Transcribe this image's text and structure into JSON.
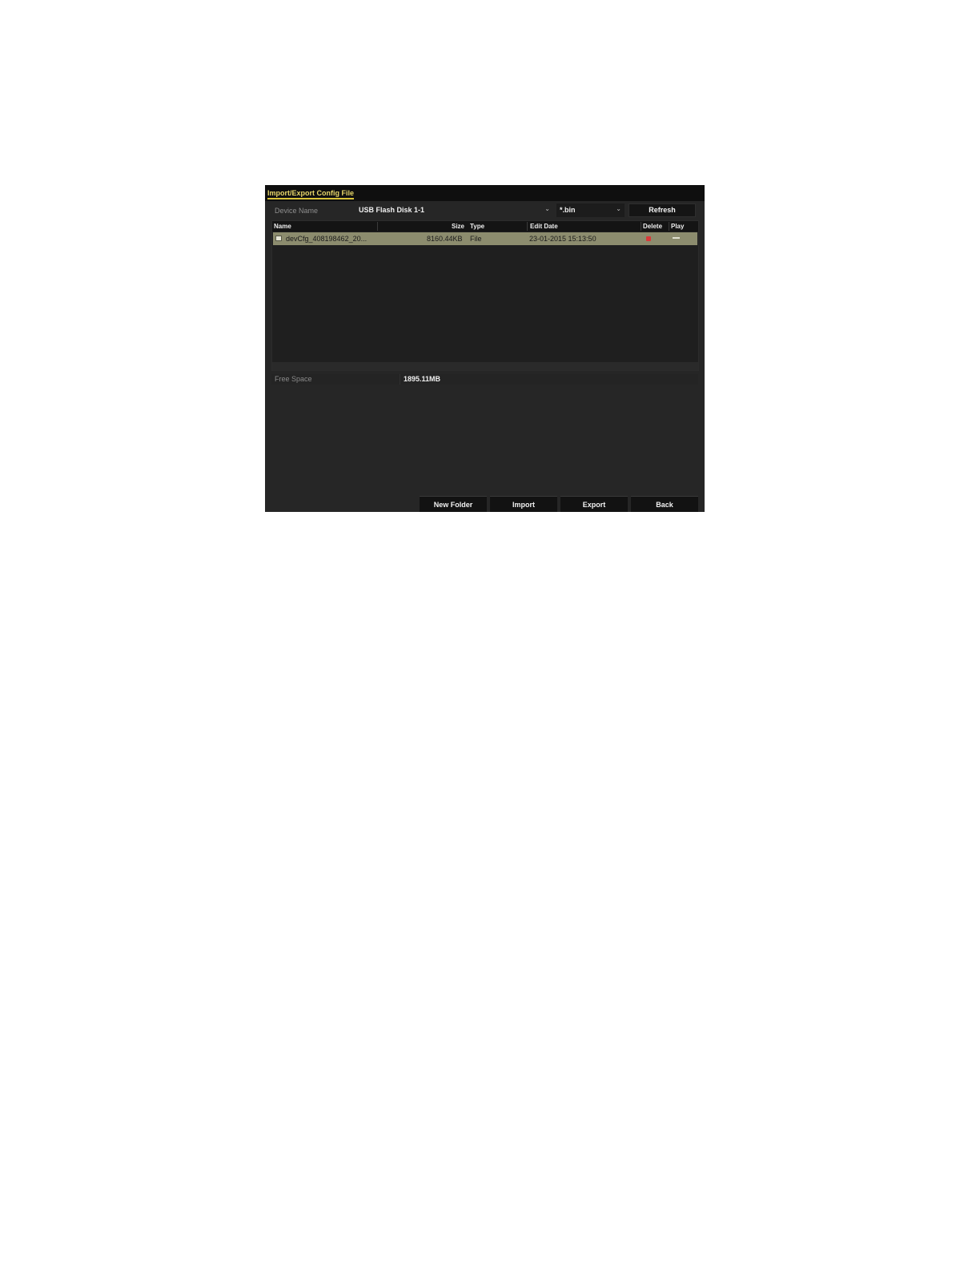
{
  "dialog": {
    "title": "Import/Export Config File"
  },
  "device": {
    "label": "Device Name",
    "selected": "USB Flash Disk 1-1",
    "filter": "*.bin",
    "refresh_label": "Refresh"
  },
  "table": {
    "columns": {
      "name": "Name",
      "size": "Size",
      "type": "Type",
      "edit_date": "Edit Date",
      "delete": "Delete",
      "play": "Play"
    },
    "rows": [
      {
        "name": "devCfg_408198462_20...",
        "size": "8160.44KB",
        "type": "File",
        "edit_date": "23-01-2015 15:13:50",
        "delete_icon": "delete-icon",
        "play_icon": "dash-icon"
      }
    ]
  },
  "storage": {
    "free_space_label": "Free Space",
    "free_space_value": "1895.11MB"
  },
  "buttons": {
    "new_folder": "New Folder",
    "import": "Import",
    "export": "Export",
    "back": "Back"
  },
  "colors": {
    "accent": "#d9c23a",
    "background": "#262626",
    "selected_row": "#8c8c6e",
    "delete": "#d83a3a"
  }
}
